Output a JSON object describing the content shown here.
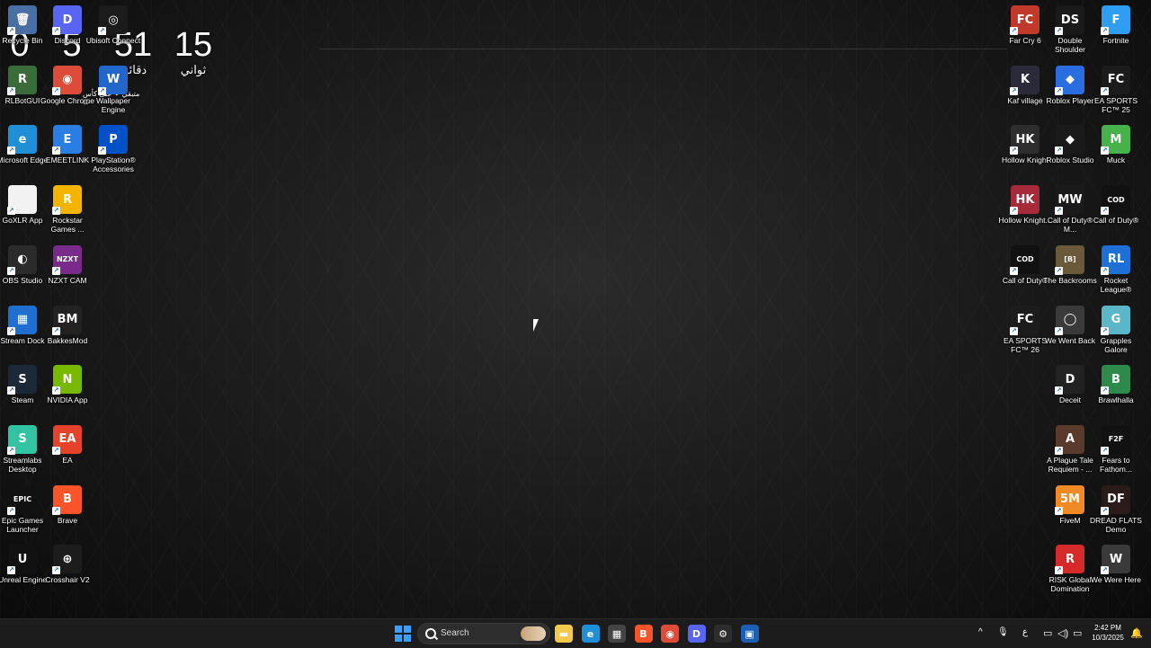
{
  "desktop": {
    "clock_widget": {
      "hours": "0",
      "minutes": "5",
      "minutes_unit": "دقائق",
      "seconds_a": "51",
      "seconds": "15",
      "seconds_unit": "ثواني",
      "overlay_text": "متبقي ❤ على كأس ت"
    },
    "left_icons": [
      {
        "label": "Recycle Bin",
        "color": "#4a6fa5",
        "icon": "recycle-bin-icon",
        "glyph": "🗑"
      },
      {
        "label": "Discord",
        "color": "#5865f2",
        "icon": "discord-icon",
        "glyph": "D"
      },
      {
        "label": "Ubisoft Connect",
        "color": "#1b1b1b",
        "icon": "ubisoft-icon",
        "glyph": "◎"
      },
      {
        "label": "RLBotGUI",
        "color": "#3a6b3a",
        "icon": "rlbot-icon",
        "glyph": "R"
      },
      {
        "label": "Google Chrome",
        "color": "#dd4b39",
        "icon": "chrome-icon",
        "glyph": "◉"
      },
      {
        "label": "Wallpaper Engine",
        "color": "#2266cc",
        "icon": "wallpaper-engine-icon",
        "glyph": "W"
      },
      {
        "label": "Microsoft Edge",
        "color": "#1f8fd6",
        "icon": "edge-icon",
        "glyph": "e"
      },
      {
        "label": "EMEETLINK",
        "color": "#2a7de1",
        "icon": "emeetlink-icon",
        "glyph": "E"
      },
      {
        "label": "PlayStation® Accessories",
        "color": "#0050c8",
        "icon": "playstation-icon",
        "glyph": "P"
      },
      {
        "label": "GoXLR App",
        "color": "#f2f2f2",
        "icon": "goxlr-icon",
        "glyph": ""
      },
      {
        "label": "Rockstar Games ...",
        "color": "#f5b400",
        "icon": "rockstar-icon",
        "glyph": "R"
      },
      {
        "label": "OBS Studio",
        "color": "#2b2b2b",
        "icon": "obs-icon",
        "glyph": "◐"
      },
      {
        "label": "NZXT CAM",
        "color": "#7a2a8a",
        "icon": "nzxt-icon",
        "glyph": "NZXT"
      },
      {
        "label": "Stream Dock",
        "color": "#1f6fd1",
        "icon": "stream-dock-icon",
        "glyph": "▦"
      },
      {
        "label": "BakkesMod",
        "color": "#222222",
        "icon": "bakkesmod-icon",
        "glyph": "BM"
      },
      {
        "label": "Steam",
        "color": "#1b2838",
        "icon": "steam-icon",
        "glyph": "S"
      },
      {
        "label": "NVIDIA App",
        "color": "#76b900",
        "icon": "nvidia-icon",
        "glyph": "N"
      },
      {
        "label": "Streamlabs Desktop",
        "color": "#31c3a2",
        "icon": "streamlabs-icon",
        "glyph": "S"
      },
      {
        "label": "EA",
        "color": "#e4422b",
        "icon": "ea-icon",
        "glyph": "EA"
      },
      {
        "label": "Epic Games Launcher",
        "color": "#111111",
        "icon": "epic-games-icon",
        "glyph": "EPIC"
      },
      {
        "label": "Brave",
        "color": "#fb542b",
        "icon": "brave-icon",
        "glyph": "B"
      },
      {
        "label": "Unreal Engine",
        "color": "#111111",
        "icon": "unreal-icon",
        "glyph": "U"
      },
      {
        "label": "Crosshair V2",
        "color": "#1c1c1c",
        "icon": "crosshair-icon",
        "glyph": "⊕"
      }
    ],
    "right_icons": [
      {
        "label": "Far Cry 6",
        "color": "#c0392b",
        "icon": "farcry-icon",
        "glyph": "FC"
      },
      {
        "label": "Double Shoulder",
        "color": "#1a1a1a",
        "icon": "double-shoulder-icon",
        "glyph": "DS"
      },
      {
        "label": "Fortnite",
        "color": "#2e9ef2",
        "icon": "fortnite-icon",
        "glyph": "F"
      },
      {
        "label": "Kaf village",
        "color": "#2a2a3a",
        "icon": "kaf-village-icon",
        "glyph": "K"
      },
      {
        "label": "Roblox Player",
        "color": "#2a6de1",
        "icon": "roblox-player-icon",
        "glyph": "◆"
      },
      {
        "label": "EA SPORTS FC™ 25",
        "color": "#1c1c1c",
        "icon": "fc25-icon",
        "glyph": "FC"
      },
      {
        "label": "Hollow Knight",
        "color": "#2d2d2d",
        "icon": "hollow-knight-icon",
        "glyph": "HK"
      },
      {
        "label": "Roblox Studio",
        "color": "#1a1a1a",
        "icon": "roblox-studio-icon",
        "glyph": "◆"
      },
      {
        "label": "Muck",
        "color": "#46b34a",
        "icon": "muck-icon",
        "glyph": "M"
      },
      {
        "label": "Hollow Knight...",
        "color": "#a62a3a",
        "icon": "hollow-knight-silksong-icon",
        "glyph": "HK"
      },
      {
        "label": "Call of Duty® M...",
        "color": "#1a1a1a",
        "icon": "cod-mw-icon",
        "glyph": "MW"
      },
      {
        "label": "Call of Duty®",
        "color": "#111111",
        "icon": "cod-icon",
        "glyph": "COD"
      },
      {
        "label": "Call of Duty®",
        "color": "#111111",
        "icon": "cod-2-icon",
        "glyph": "COD"
      },
      {
        "label": "The Backrooms",
        "color": "#6b5a3a",
        "icon": "backrooms-icon",
        "glyph": "[B]"
      },
      {
        "label": "Rocket League®",
        "color": "#1e6fd6",
        "icon": "rocket-league-icon",
        "glyph": "RL"
      },
      {
        "label": "EA SPORTS FC™ 26",
        "color": "#1c1c1c",
        "icon": "fc26-icon",
        "glyph": "FC"
      },
      {
        "label": "We Went Back",
        "color": "#3a3a3a",
        "icon": "we-went-back-icon",
        "glyph": "◯"
      },
      {
        "label": "Grapples Galore",
        "color": "#5bb6c9",
        "icon": "grapples-icon",
        "glyph": "G"
      },
      {
        "label": "Deceit",
        "color": "#222222",
        "icon": "deceit-icon",
        "glyph": "D"
      },
      {
        "label": "Brawlhalla",
        "color": "#2d8a4a",
        "icon": "brawlhalla-icon",
        "glyph": "B"
      },
      {
        "label": "A Plague Tale Requiem - ...",
        "color": "#5a3a2a",
        "icon": "plague-tale-icon",
        "glyph": "A"
      },
      {
        "label": "Fears to Fathom...",
        "color": "#111111",
        "icon": "fears-to-fathom-icon",
        "glyph": "F2F"
      },
      {
        "label": "FiveM",
        "color": "#f08a24",
        "icon": "fivem-icon",
        "glyph": "5M"
      },
      {
        "label": "DREAD FLATS Demo",
        "color": "#2a1a1a",
        "icon": "dread-flats-icon",
        "glyph": "DF"
      },
      {
        "label": "RISK Global Domination",
        "color": "#d62a2a",
        "icon": "risk-icon",
        "glyph": "R"
      },
      {
        "label": "We Were Here",
        "color": "#3a3a3a",
        "icon": "we-were-here-icon",
        "glyph": "W"
      }
    ]
  },
  "taskbar": {
    "search_placeholder": "Search",
    "pinned": [
      {
        "name": "file-explorer-icon",
        "color": "#f2c94c",
        "glyph": "▬"
      },
      {
        "name": "edge-taskbar-icon",
        "color": "#1f8fd6",
        "glyph": "e"
      },
      {
        "name": "store-icon",
        "color": "#444444",
        "glyph": "▦"
      },
      {
        "name": "brave-taskbar-icon",
        "color": "#fb542b",
        "glyph": "B"
      },
      {
        "name": "chrome-taskbar-icon",
        "color": "#dd4b39",
        "glyph": "◉"
      },
      {
        "name": "discord-taskbar-icon",
        "color": "#5865f2",
        "glyph": "D"
      },
      {
        "name": "settings-taskbar-icon",
        "color": "#2d2d2d",
        "glyph": "⚙"
      },
      {
        "name": "app-taskbar-icon",
        "color": "#1a5fb4",
        "glyph": "▣"
      }
    ],
    "tray": {
      "chevron": "^",
      "mic": "🎙",
      "lang": "ع",
      "time": "2:42 PM",
      "date": "10/3/2025"
    }
  }
}
